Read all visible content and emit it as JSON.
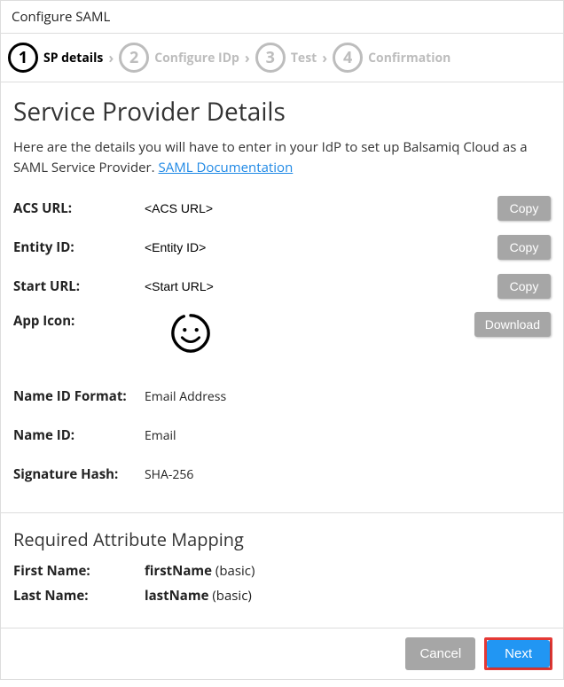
{
  "title": "Configure SAML",
  "steps": [
    {
      "num": "1",
      "label": "SP details",
      "active": true
    },
    {
      "num": "2",
      "label": "Configure IDp",
      "active": false
    },
    {
      "num": "3",
      "label": "Test",
      "active": false
    },
    {
      "num": "4",
      "label": "Confirmation",
      "active": false
    }
  ],
  "heading": "Service Provider Details",
  "intro_text": "Here are the details you will have to enter in your IdP to set up Balsamiq Cloud as a SAML Service Provider. ",
  "intro_link": "SAML Documentation",
  "fields": {
    "acs_label": "ACS URL:",
    "acs_value": "<ACS URL>",
    "entity_label": "Entity ID:",
    "entity_value": "<Entity ID>",
    "start_label": "Start URL:",
    "start_value": "<Start URL>",
    "icon_label": "App Icon:",
    "nameid_format_label": "Name ID Format:",
    "nameid_format_value": "Email Address",
    "nameid_label": "Name ID:",
    "nameid_value": "Email",
    "sig_label": "Signature Hash:",
    "sig_value": "SHA-256"
  },
  "buttons": {
    "copy": "Copy",
    "download": "Download",
    "cancel": "Cancel",
    "next": "Next"
  },
  "attr_heading": "Required Attribute Mapping",
  "attrs": {
    "first_label": "First Name:",
    "first_bold": "firstName",
    "first_extra": " (basic)",
    "last_label": "Last Name:",
    "last_bold": "lastName",
    "last_extra": " (basic)"
  }
}
